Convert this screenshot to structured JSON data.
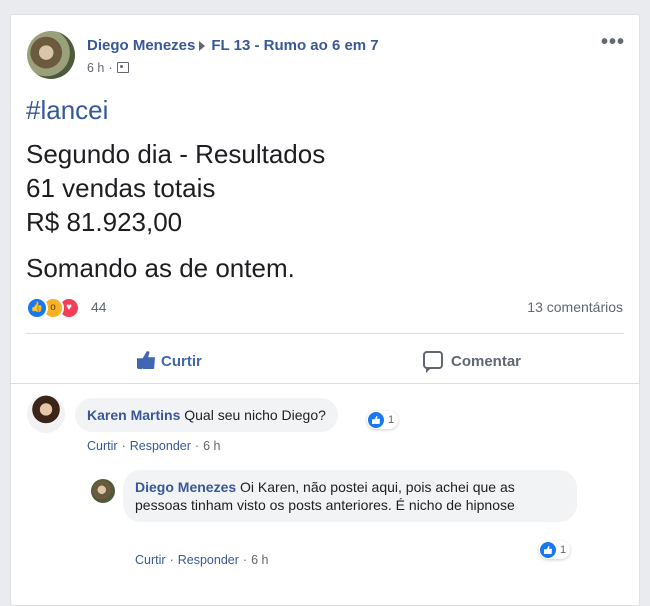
{
  "post": {
    "author": "Diego Menezes",
    "group": "FL 13 - Rumo ao 6 em 7",
    "time": "6 h",
    "more_label": "•••",
    "lines": [
      "#lancei",
      "Segundo dia - Resultados",
      "61 vendas totais",
      "R$ 81.923,00",
      "Somando as de ontem."
    ],
    "reaction_count": "44",
    "comments_count": "13 comentários",
    "like_label": "Curtir",
    "comment_label": "Comentar"
  },
  "comments": [
    {
      "author": "Karen Martins",
      "text": "Qual seu nicho Diego?",
      "reactions": "1",
      "like": "Curtir",
      "reply": "Responder",
      "time": "6 h"
    },
    {
      "author": "Diego Menezes",
      "text": "Oi Karen, não postei aqui, pois achei que as pessoas tinham visto os posts anteriores. É nicho de hipnose",
      "reactions": "1",
      "like": "Curtir",
      "reply": "Responder",
      "time": "6 h"
    }
  ],
  "colors": {
    "link": "#385898",
    "like_blue": "#4267b2",
    "background": "#e9ebee"
  },
  "icons": [
    "like-reaction-icon",
    "wow-reaction-icon",
    "love-reaction-icon",
    "thumbs-up-icon",
    "comment-bubble-icon",
    "audience-icon",
    "more-options-icon"
  ]
}
